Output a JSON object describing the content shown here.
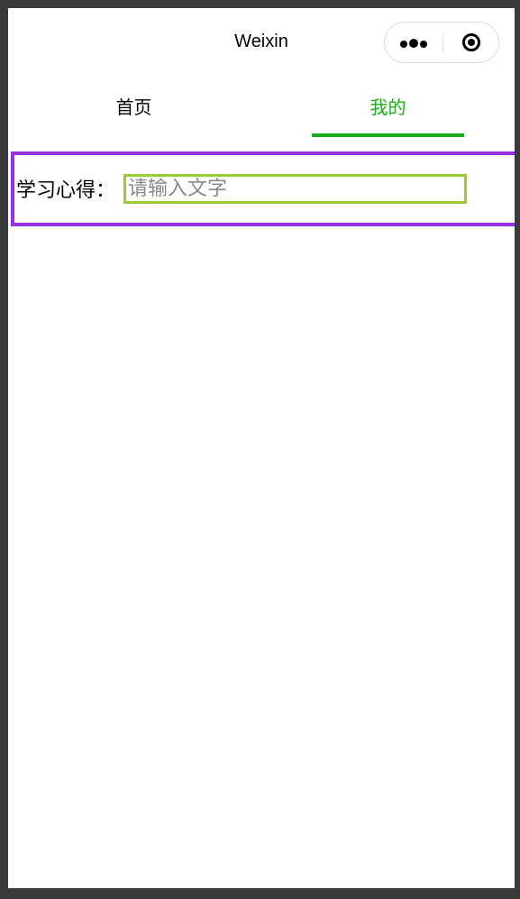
{
  "navbar": {
    "title": "Weixin",
    "more_icon": "more-dots-icon",
    "close_icon": "target-icon"
  },
  "tabs": [
    {
      "label": "首页",
      "active": false
    },
    {
      "label": "我的",
      "active": true
    }
  ],
  "form": {
    "label": "学习心得：",
    "input_value": "",
    "input_placeholder": "请输入文字"
  },
  "colors": {
    "active_tab": "#1aad19",
    "form_border": "#9b30e0",
    "input_border": "#9acd32",
    "frame": "#3a3a3a"
  }
}
